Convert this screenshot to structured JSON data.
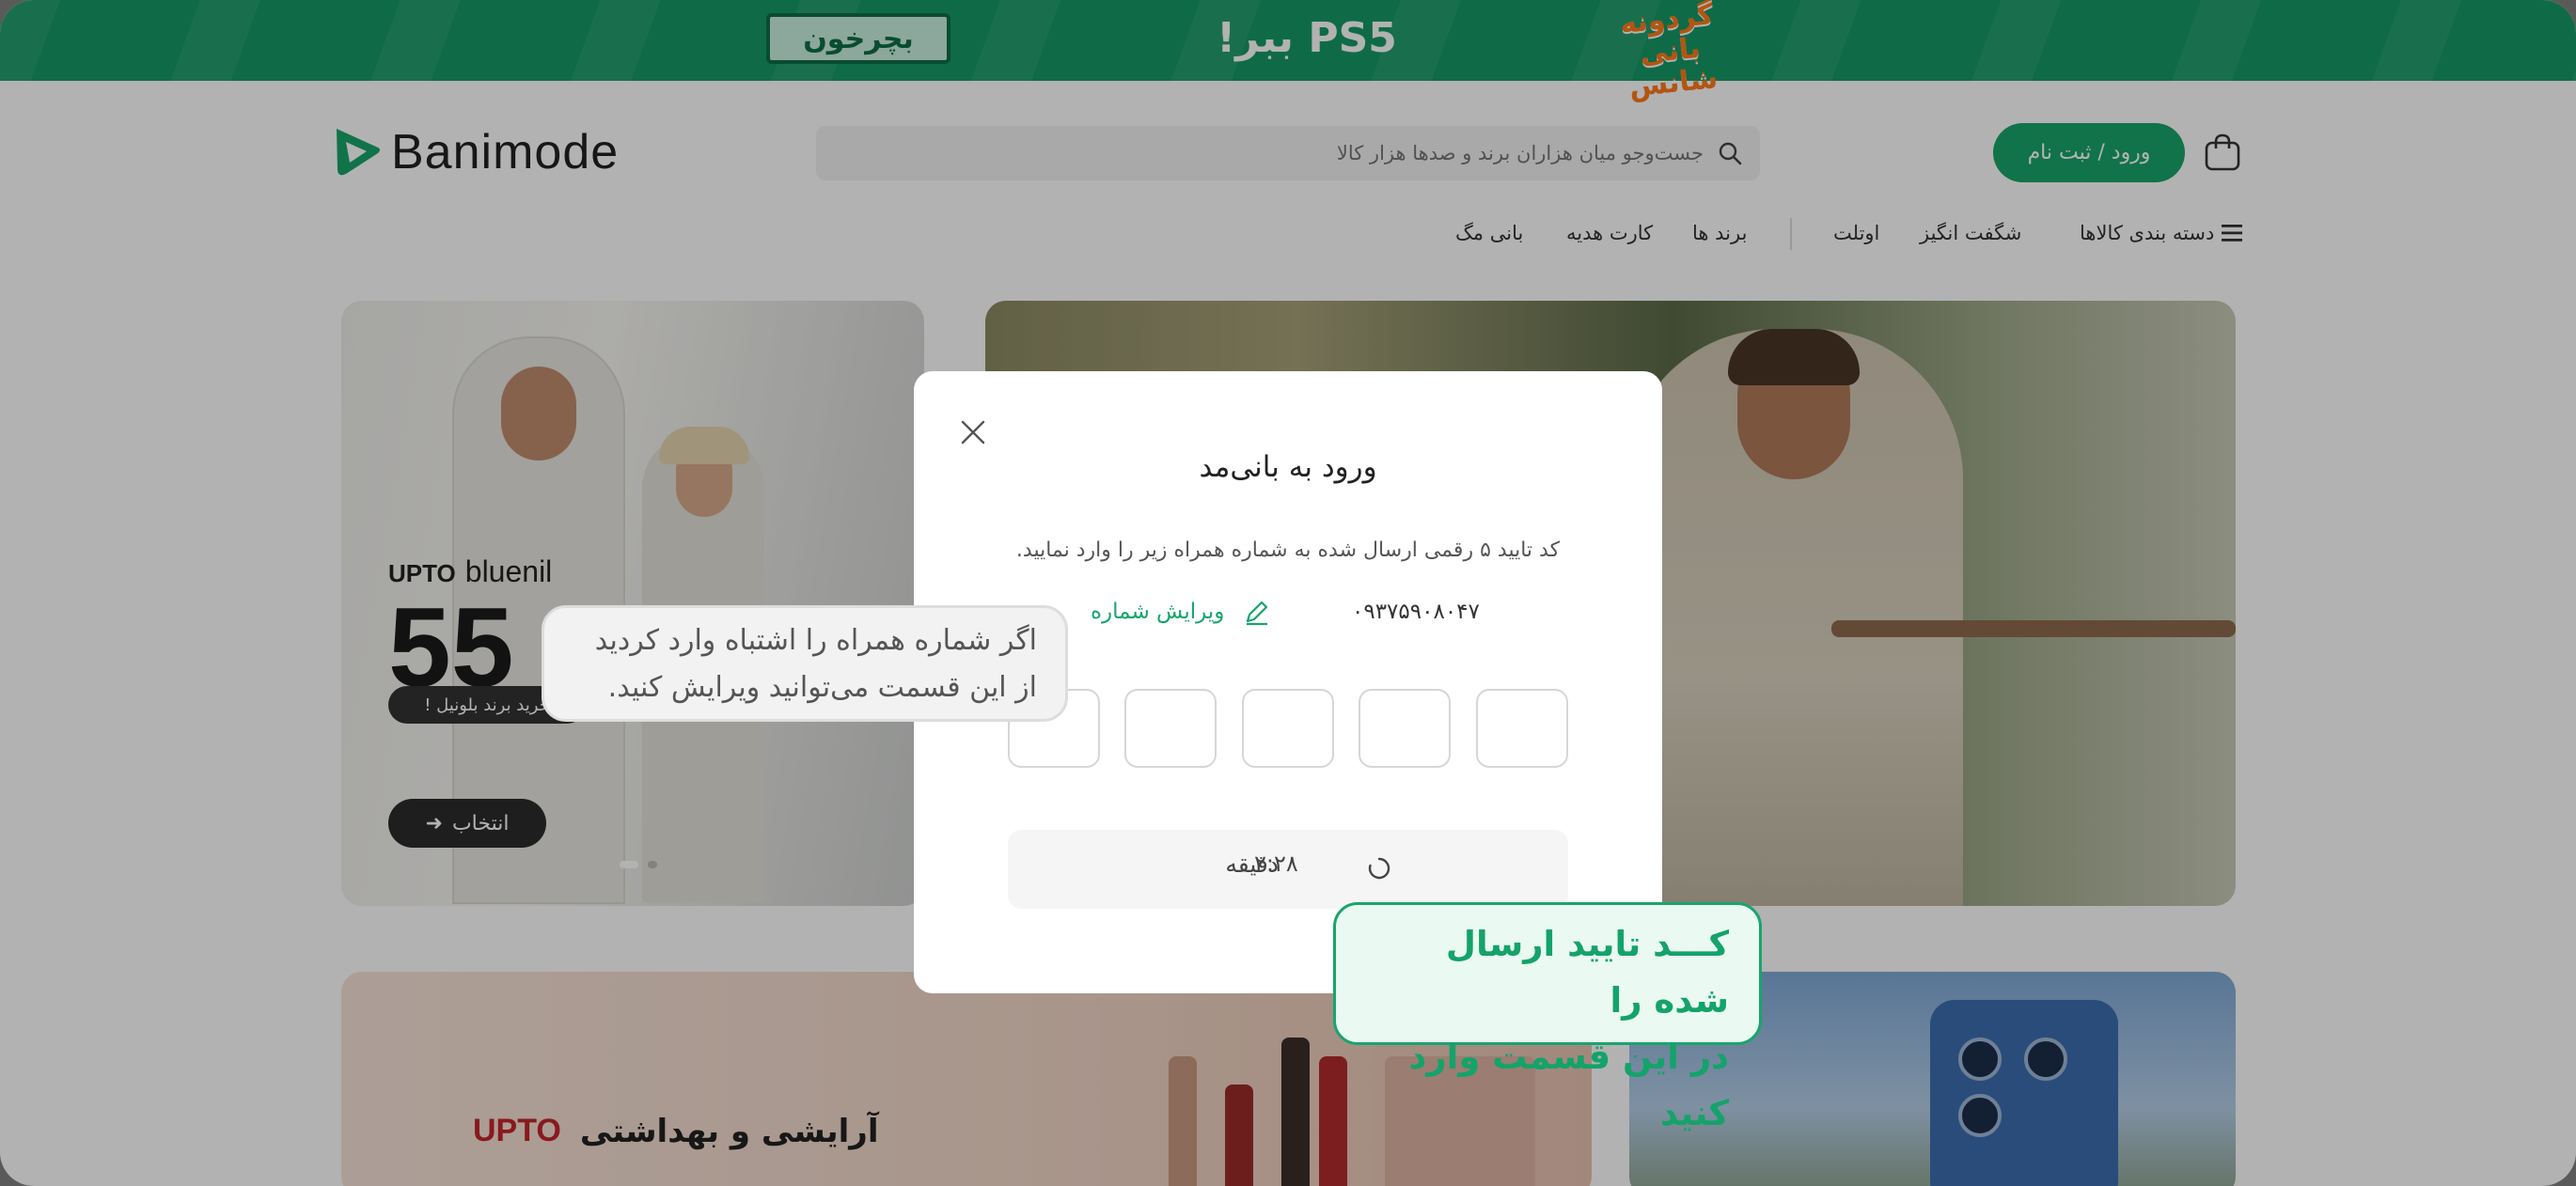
{
  "promo": {
    "cta_label": "بچرخون",
    "headline": "PS5 ببر!",
    "brand_line_1": "گردونه",
    "brand_line_2": "بانی شانس"
  },
  "header": {
    "logo_text": "Banimode",
    "search_placeholder": "جست‌وجو میان هزاران برند و صدها هزار کالا",
    "login_label": "ورود / ثبت نام"
  },
  "nav": {
    "categories_label": "دسته بندی کالاها",
    "items": [
      "شگفت انگیز",
      "اوتلت",
      "برند ها",
      "کارت هدیه",
      "بانی مگ"
    ]
  },
  "banners": {
    "b1_brand": "bluenil",
    "b1_upto": "UPTO",
    "b1_percent": "55",
    "b1_pill": "خرید برند بلونیل !",
    "b1_button": "انتخاب",
    "b3_title": "آرایشی و بهداشتی",
    "b3_upto": "UPTO"
  },
  "modal": {
    "title": "ورود به بانی‌مد",
    "instruction": "کد تایید ۵ رقمی ارسال شده به شماره همراه زیر را وارد نمایید.",
    "phone_number": "۰۹۳۷۵۹۰۸۰۴۷",
    "edit_label": "ویرایش شماره",
    "otp_length": 5,
    "timer_value": "۲:۲۸",
    "timer_unit": "دقیقه"
  },
  "tooltips": {
    "edit_line_1": "اگر شماره همراه را اشتباه وارد کردید",
    "edit_line_2": "از این قسمت می‌توانید ویرایش کنید.",
    "code_line_1": "کـــد تایید ارسال شده را",
    "code_line_2": "در این قسمت وارد کنید"
  },
  "colors": {
    "brand_green": "#18a56b",
    "promo_green": "#169a66",
    "overlay": "rgba(0,0,0,0.30)"
  },
  "icons": [
    "search-icon",
    "cart-icon",
    "menu-icon",
    "close-icon",
    "pencil-icon",
    "loading-icon",
    "arrow-left-icon"
  ]
}
